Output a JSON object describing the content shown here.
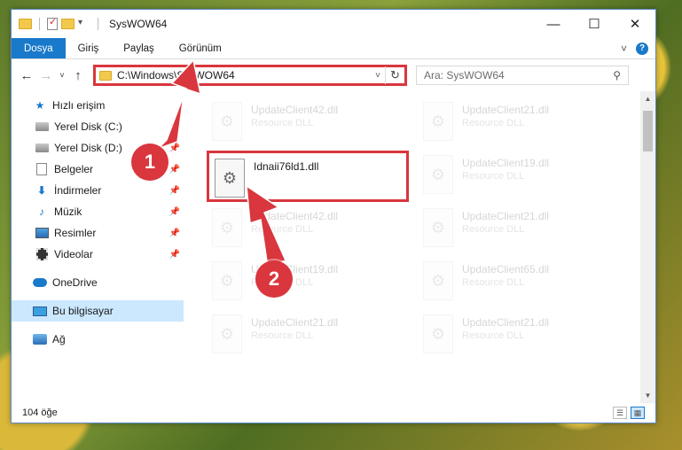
{
  "window": {
    "title": "SysWOW64",
    "minimize": "—",
    "maximize": "☐",
    "close": "✕"
  },
  "ribbon": {
    "tabs": [
      "Dosya",
      "Giriş",
      "Paylaş",
      "Görünüm"
    ],
    "expand_icon": "˅",
    "help_icon": "?"
  },
  "address": {
    "path": "C:\\Windows\\SysWOW64",
    "search_placeholder": "Ara: SysWOW64"
  },
  "sidebar": {
    "quick_access": "Hızlı erişim",
    "items": [
      {
        "label": "Yerel Disk (C:)",
        "icon": "drive-icon"
      },
      {
        "label": "Yerel Disk (D:)",
        "icon": "drive-icon"
      },
      {
        "label": "Belgeler",
        "icon": "documents-icon"
      },
      {
        "label": "İndirmeler",
        "icon": "downloads-icon"
      },
      {
        "label": "Müzik",
        "icon": "music-icon"
      },
      {
        "label": "Resimler",
        "icon": "pictures-icon"
      },
      {
        "label": "Videolar",
        "icon": "videos-icon"
      }
    ],
    "onedrive": "OneDrive",
    "this_pc": "Bu bilgisayar",
    "network": "Ağ"
  },
  "files": {
    "highlighted": {
      "name": "Idnaii76ld1.dll"
    },
    "items": [
      {
        "name": "UpdateClient42.dll",
        "type": "Resource DLL"
      },
      {
        "name": "UpdateClient21.dll",
        "type": "Resource DLL"
      },
      {
        "name": "UpdateClient19.dll",
        "type": "Resource DLL"
      },
      {
        "name": "UpdateClient42.dll",
        "type": "Resource DLL"
      },
      {
        "name": "UpdateClient21.dll",
        "type": "Resource DLL"
      },
      {
        "name": "UpdateClient19.dll",
        "type": "Resource DLL"
      },
      {
        "name": "UpdateClient65.dll",
        "type": "Resource DLL"
      },
      {
        "name": "UpdateClient21.dll",
        "type": "Resource DLL"
      },
      {
        "name": "UpdateClient21.dll",
        "type": "Resource DLL"
      }
    ]
  },
  "status": {
    "item_count": "104 öğe"
  },
  "annotations": {
    "step1": "1",
    "step2": "2",
    "color": "#d9363e"
  }
}
